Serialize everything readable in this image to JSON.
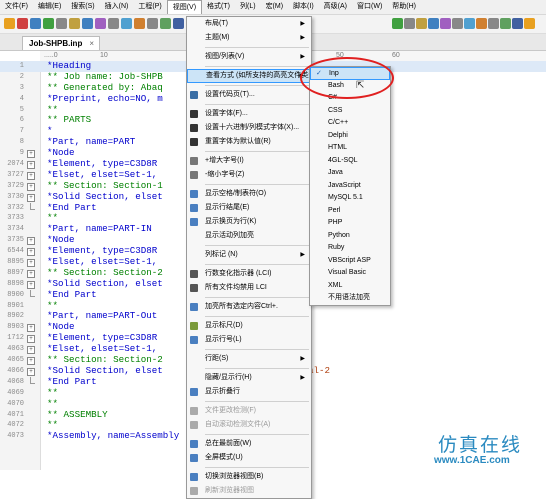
{
  "menubar": [
    "文件(F)",
    "编辑(E)",
    "搜索(S)",
    "插入(N)",
    "工程(P)",
    "视图(V)",
    "格式(T)",
    "列(L)",
    "宏(M)",
    "脚本(I)",
    "高级(A)",
    "窗口(W)",
    "帮助(H)"
  ],
  "tab": {
    "title": "Job-SHPB.inp",
    "close": "×"
  },
  "ruler": [
    ".....0",
    "10",
    "50",
    "60"
  ],
  "lines": [
    {
      "n": "1",
      "t": "*Heading",
      "hl": true
    },
    {
      "n": "2",
      "t": "** Job name: Job-SHPB"
    },
    {
      "n": "3",
      "t": "** Generated by: Abaq"
    },
    {
      "n": "4",
      "t": "*Preprint, echo=NO, m"
    },
    {
      "n": "5",
      "t": "**"
    },
    {
      "n": "6",
      "t": "** PARTS"
    },
    {
      "n": "7",
      "t": "*"
    },
    {
      "n": "8",
      "t": "*Part, name=PART"
    },
    {
      "n": "9",
      "t": "*Node",
      "fold": "+"
    },
    {
      "n": "2074",
      "t": "*Element, type=C3D8R",
      "fold": "+"
    },
    {
      "n": "3727",
      "t": "*Elset, elset=Set-1,",
      "fold": "+"
    },
    {
      "n": "3729",
      "t": "** Section: Section-1",
      "fold": "+"
    },
    {
      "n": "3730",
      "t": "*Solid Section, elset",
      "fold": "+"
    },
    {
      "n": "3732",
      "t": "*End Part",
      "fold": "end"
    },
    {
      "n": "3733",
      "t": "**"
    },
    {
      "n": "3734",
      "t": "*Part, name=PART-IN"
    },
    {
      "n": "3735",
      "t": "*Node",
      "fold": "+"
    },
    {
      "n": "6544",
      "t": "*Element, type=C3D8R",
      "fold": "+"
    },
    {
      "n": "8895",
      "t": "*Elset, elset=Set-1,",
      "fold": "+"
    },
    {
      "n": "8897",
      "t": "** Section: Section-2",
      "fold": "+"
    },
    {
      "n": "8898",
      "t": "*Solid Section, elset",
      "fold": "+"
    },
    {
      "n": "8900",
      "t": "*End Part",
      "fold": "end"
    },
    {
      "n": "8901",
      "t": "**"
    },
    {
      "n": "8902",
      "t": "*Part, name=PART-Out"
    },
    {
      "n": "8903",
      "t": "*Node",
      "fold": "+"
    },
    {
      "n": "1712",
      "t": "*Element, type=C3D8R",
      "fold": "+"
    },
    {
      "n": "4063",
      "t": "*Elset, elset=Set-1,",
      "fold": "+"
    },
    {
      "n": "4065",
      "t": "** Section: Section-2",
      "fold": "+"
    },
    {
      "n": "4066",
      "t": "*Solid Section, elset",
      "fold": "+",
      "tail": "al-2"
    },
    {
      "n": "4068",
      "t": "*End Part",
      "fold": "end"
    },
    {
      "n": "4069",
      "t": "**"
    },
    {
      "n": "4070",
      "t": "**"
    },
    {
      "n": "4071",
      "t": "** ASSEMBLY"
    },
    {
      "n": "4072",
      "t": "**"
    },
    {
      "n": "4073",
      "t": "*Assembly, name=Assembly"
    }
  ],
  "view_menu": [
    {
      "label": "布局(T)",
      "arrow": "▶"
    },
    {
      "label": "主题(M)",
      "arrow": "▶"
    },
    {
      "sep": true
    },
    {
      "label": "视图/列表(V)",
      "arrow": "▶"
    },
    {
      "sep": true
    },
    {
      "label": "查看方式 (如所支持的高亮文件类型)(V)",
      "arrow": "▶",
      "sel": true
    },
    {
      "sep": true
    },
    {
      "label": "设置代码页(T)...",
      "icon": "#3a6ea5"
    },
    {
      "sep": true
    },
    {
      "label": "设置字体(F)...",
      "icon": "#333333"
    },
    {
      "label": "设置十六进制/列模式字体(X)...",
      "icon": "#333333"
    },
    {
      "label": "重置字体为默认值(R)",
      "icon": "#333333"
    },
    {
      "sep": true
    },
    {
      "label": "+增大字号(I)",
      "icon": "#777777"
    },
    {
      "label": "-缩小字号(Z)",
      "icon": "#777777"
    },
    {
      "sep": true
    },
    {
      "label": "显示空格/制表符(O)",
      "icon": "#4a7fc0"
    },
    {
      "label": "显示行结尾(E)",
      "icon": "#4a7fc0"
    },
    {
      "label": "显示换页为行(K)",
      "icon": "#4a7fc0"
    },
    {
      "label": "显示活动列加亮"
    },
    {
      "sep": true
    },
    {
      "label": "列标记 (N)",
      "arrow": "▶"
    },
    {
      "sep": true
    },
    {
      "label": "行数变化指示器 (LCI)",
      "icon": "#555555"
    },
    {
      "label": "所有文件均禁用 LCI",
      "icon": "#555555"
    },
    {
      "sep": true
    },
    {
      "label": "加亮所有选定内容Ctrl+.",
      "sc": "Ctrl+.",
      "icon": "#4a7fc0"
    },
    {
      "sep": true
    },
    {
      "label": "显示标尺(D)",
      "icon": "#7a9a3a"
    },
    {
      "label": "显示行号(L)",
      "icon": "#4a7fc0"
    },
    {
      "sep": true
    },
    {
      "label": "行距(S)",
      "arrow": "▶"
    },
    {
      "sep": true
    },
    {
      "label": "隐藏/显示行(H)",
      "arrow": "▶"
    },
    {
      "label": "显示折叠行",
      "icon": "#4a7fc0"
    },
    {
      "sep": true
    },
    {
      "label": "文件更改检测(F)",
      "dis": true,
      "icon": "#aaaaaa"
    },
    {
      "label": "自动滚动检测文件(A)",
      "dis": true,
      "icon": "#aaaaaa"
    },
    {
      "sep": true
    },
    {
      "label": "总在最前面(W)",
      "icon": "#4a7fc0"
    },
    {
      "label": "全屏模式(U)",
      "icon": "#4a7fc0"
    },
    {
      "sep": true
    },
    {
      "label": "切换浏览器视图(B)",
      "icon": "#4a7fc0"
    },
    {
      "label": "刷新浏览器视图",
      "dis": true,
      "icon": "#aaaaaa"
    }
  ],
  "highlight_submenu": [
    "Inp",
    "Bash",
    "C#",
    "CSS",
    "C/C++",
    "Delphi",
    "HTML",
    "4GL-SQL",
    "Java",
    "JavaScript",
    "MySQL 5.1",
    "Perl",
    "PHP",
    "Python",
    "Ruby",
    "VBScript ASP",
    "Visual Basic",
    "XML",
    "不用语法加亮"
  ],
  "highlight_selected": "✓",
  "watermark": {
    "cn": "仿真在线",
    "url": "www.1CAE.com"
  },
  "colors": {
    "accent": "#3399ff",
    "watermark": "#2a8ac0",
    "annotation": "#e02020"
  }
}
